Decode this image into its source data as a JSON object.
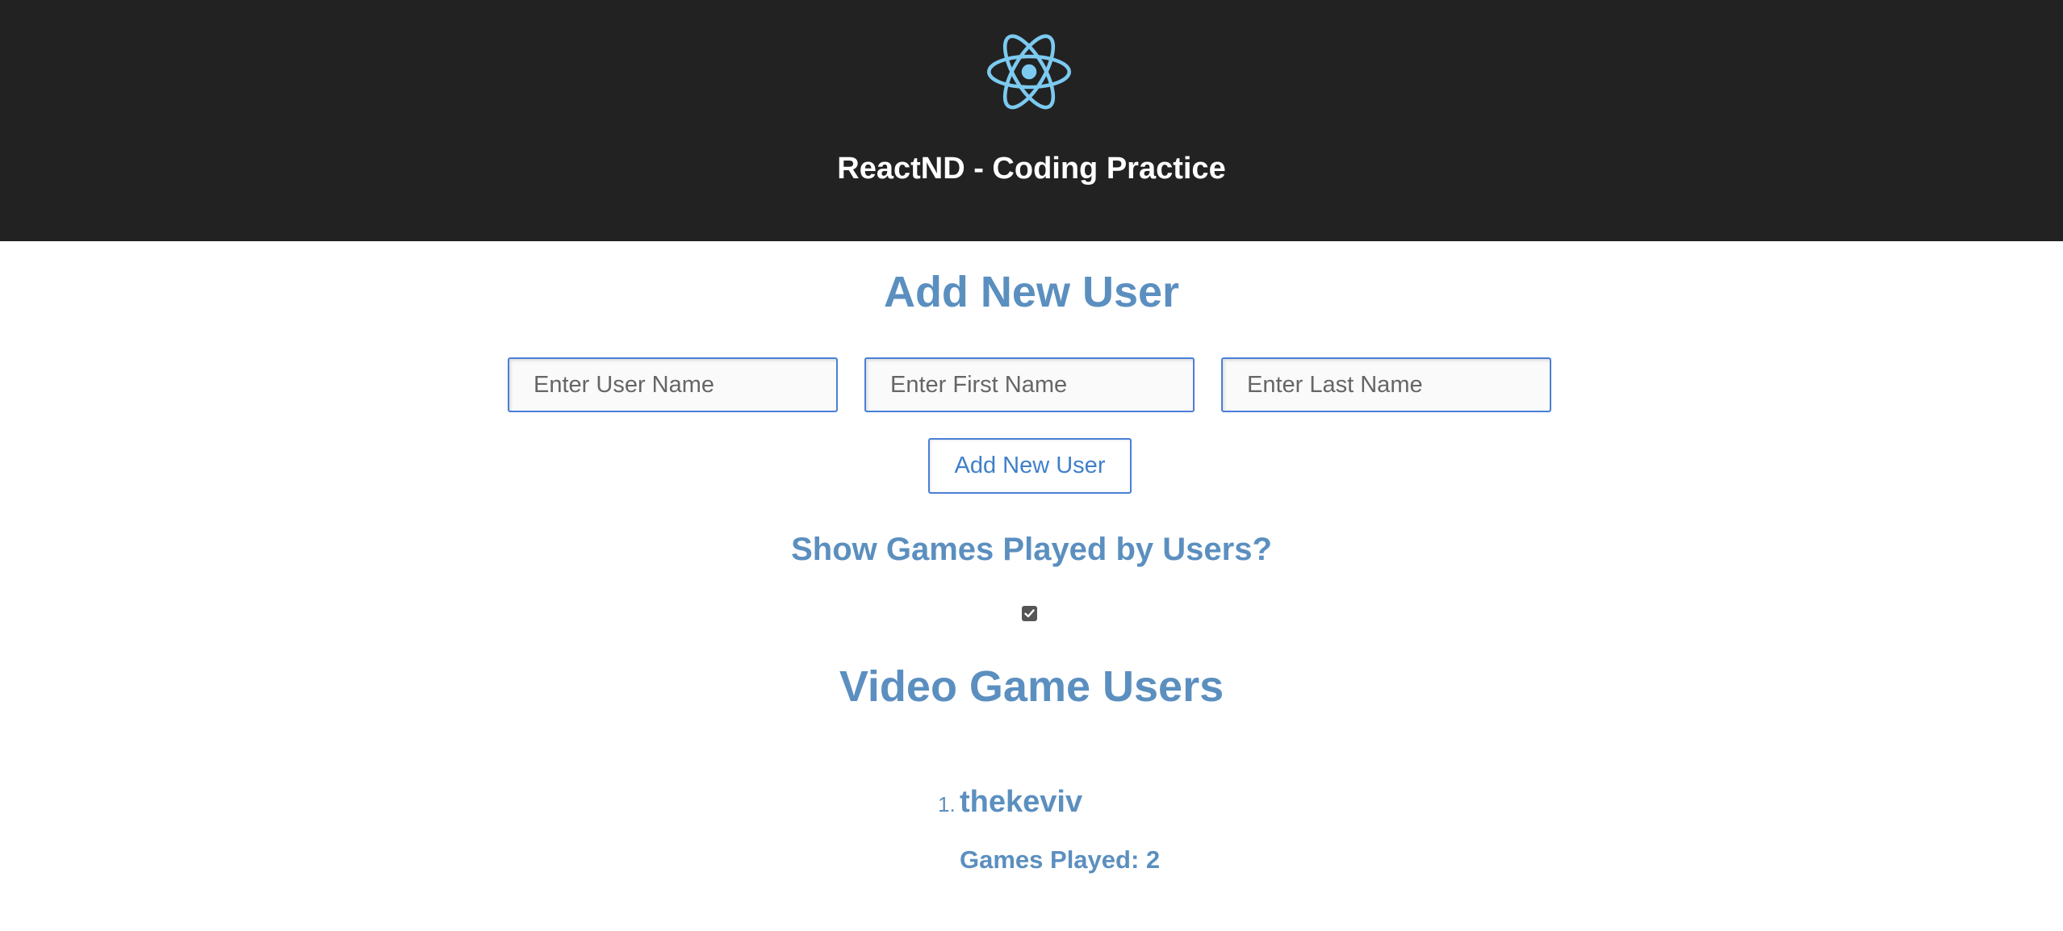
{
  "header": {
    "logo_icon": "react-atom-icon",
    "title": "ReactND - Coding Practice",
    "background_color": "#222222",
    "logo_color": "#61dafb"
  },
  "add_user": {
    "title": "Add New User",
    "username_placeholder": "Enter User Name",
    "firstname_placeholder": "Enter First Name",
    "lastname_placeholder": "Enter Last Name",
    "button_label": "Add New User"
  },
  "games_toggle": {
    "label": "Show Games Played by Users?",
    "checked": true
  },
  "users": {
    "title": "Video Game Users",
    "list": [
      {
        "number": "1.",
        "username": "thekeviv",
        "games_played_text": "Games Played: 2"
      }
    ]
  },
  "colors": {
    "accent": "#5b8fbf",
    "input_border": "#4a7fd6"
  }
}
